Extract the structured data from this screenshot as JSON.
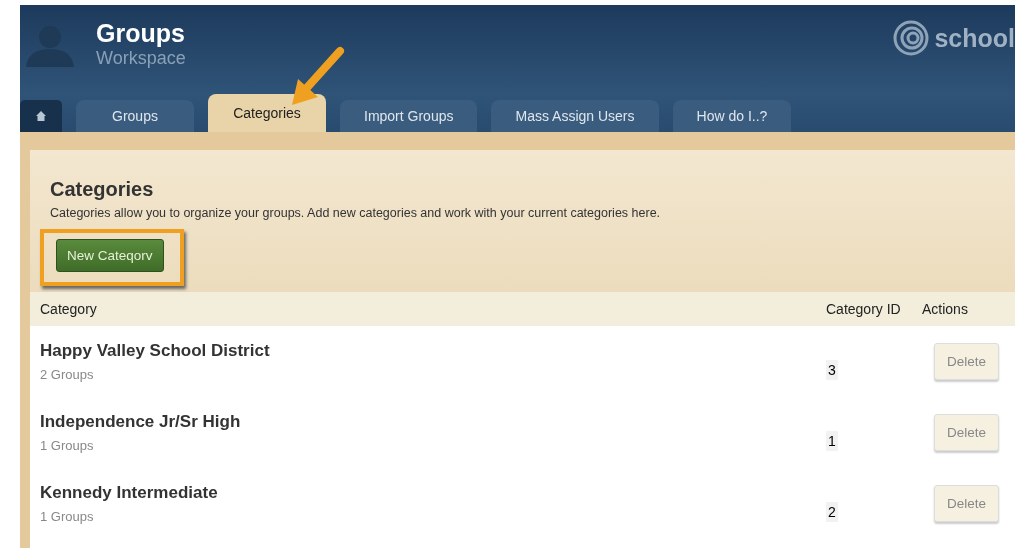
{
  "header": {
    "title": "Groups",
    "subtitle": "Workspace",
    "logo_text": "school"
  },
  "tabs": [
    {
      "label": "Groups",
      "selected": false
    },
    {
      "label": "Categories",
      "selected": true
    },
    {
      "label": "Import Groups",
      "selected": false
    },
    {
      "label": "Mass Assign Users",
      "selected": false
    },
    {
      "label": "How do I..?",
      "selected": false
    }
  ],
  "page": {
    "title": "Categories",
    "description": "Categories allow you to organize your groups. Add new categories and work with your current categories here.",
    "new_button": "New Cateqorv"
  },
  "table": {
    "columns": [
      "Category",
      "Category ID",
      "Actions"
    ],
    "rows": [
      {
        "name": "Happy Valley School District",
        "groups": "2 Groups",
        "id": "3",
        "action": "Delete"
      },
      {
        "name": "Independence Jr/Sr High",
        "groups": "1 Groups",
        "id": "1",
        "action": "Delete"
      },
      {
        "name": "Kennedy Intermediate",
        "groups": "1 Groups",
        "id": "2",
        "action": "Delete"
      }
    ]
  }
}
